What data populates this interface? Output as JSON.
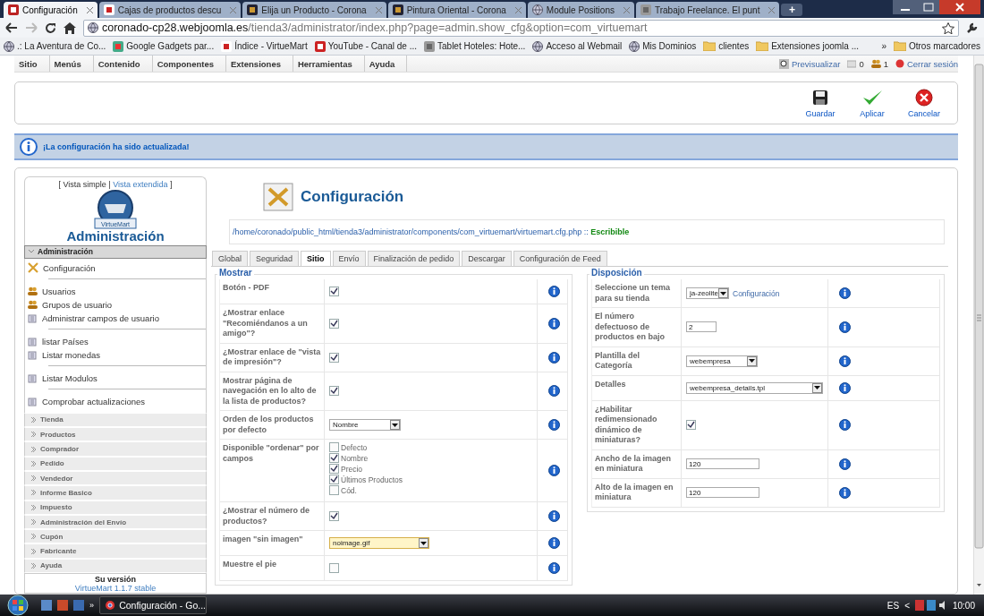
{
  "browser": {
    "tabs": [
      {
        "title": "Configuración",
        "kind": "joomla",
        "selected": true
      },
      {
        "title": "Cajas de productos descu",
        "kind": "w",
        "selected": false
      },
      {
        "title": "Elija un Producto - Corona",
        "kind": "puzzle",
        "selected": false
      },
      {
        "title": "Pintura Oriental - Corona",
        "kind": "puzzle",
        "selected": false
      },
      {
        "title": "Module Positions",
        "kind": "globe",
        "selected": false
      },
      {
        "title": "Trabajo Freelance. El punt",
        "kind": "square",
        "selected": false
      }
    ],
    "new_tab": "+",
    "address": {
      "host": "coronado-cp28.webjoomla.es",
      "path": "/tienda3/administrator/index.php?page=admin.show_cfg&option=com_virtuemart"
    },
    "bookmarks": [
      {
        "label": ".: La Aventura de Co...",
        "kind": "globe"
      },
      {
        "label": "Google Gadgets par...",
        "kind": "google"
      },
      {
        "label": "Índice - VirtueMart",
        "kind": "w"
      },
      {
        "label": "YouTube - Canal de ...",
        "kind": "youtube"
      },
      {
        "label": "Tablet Hoteles: Hote...",
        "kind": "square"
      },
      {
        "label": "Acceso al Webmail",
        "kind": "globe"
      },
      {
        "label": "Mis Dominios",
        "kind": "globe"
      },
      {
        "label": "clientes",
        "kind": "folder"
      },
      {
        "label": "Extensiones joomla ...",
        "kind": "folder"
      }
    ],
    "more": "»",
    "other_bookmarks": "Otros marcadores"
  },
  "admin_menu": {
    "items": [
      "Sitio",
      "Menús",
      "Contenido",
      "Componentes",
      "Extensiones",
      "Herramientas",
      "Ayuda"
    ],
    "preview": "Previsualizar",
    "messages": "0",
    "users": "1",
    "logout": "Cerrar sesión"
  },
  "toolbar": [
    {
      "label": "Guardar",
      "kind": "save"
    },
    {
      "label": "Aplicar",
      "kind": "apply"
    },
    {
      "label": "Cancelar",
      "kind": "cancel"
    }
  ],
  "message": "¡La configuración ha sido actualizada!",
  "sidebar": {
    "view_open": "[",
    "views": [
      {
        "label": "Vista simple",
        "selected": true
      },
      {
        "label": "Vista extendida",
        "selected": false
      }
    ],
    "view_separator": "|",
    "view_close": "]",
    "logo_label": "VirtueMart",
    "title": "Administración",
    "section": {
      "title": "Administración",
      "expanded": true,
      "groups": [
        [
          {
            "label": "Configuración",
            "kind": "tools"
          }
        ],
        [
          {
            "label": "Usuarios",
            "kind": "users"
          },
          {
            "label": "Grupos de usuario",
            "kind": "users"
          },
          {
            "label": "Administrar campos de usuario",
            "kind": "list"
          }
        ],
        [
          {
            "label": "listar Países",
            "kind": "list"
          },
          {
            "label": "Listar monedas",
            "kind": "list"
          }
        ],
        [
          {
            "label": "Listar Modulos",
            "kind": "list"
          }
        ],
        [
          {
            "label": "Comprobar actualizaciones",
            "kind": "list"
          }
        ]
      ]
    },
    "collapsed": [
      {
        "title": "Tienda",
        "expanded": false
      },
      {
        "title": "Productos",
        "expanded": false
      },
      {
        "title": "Comprador",
        "expanded": false
      },
      {
        "title": "Pedido",
        "expanded": false
      },
      {
        "title": "Vendedor",
        "expanded": false
      },
      {
        "title": "Informe Basico",
        "expanded": false
      },
      {
        "title": "Impuesto",
        "expanded": false
      },
      {
        "title": "Administración del Envío",
        "expanded": false
      },
      {
        "title": "Cupón",
        "expanded": false
      },
      {
        "title": "Fabricante",
        "expanded": false
      },
      {
        "title": "Ayuda",
        "expanded": false
      }
    ],
    "version_label": "Su versión",
    "version_link": "VirtueMart 1.1.7 stable"
  },
  "content": {
    "title": "Configuración",
    "path": "/home/coronado/public_html/tienda3/administrator/components/com_virtuemart/virtuemart.cfg.php :: **Escribible**",
    "tabs": [
      {
        "label": "Global",
        "selected": false
      },
      {
        "label": "Seguridad",
        "selected": false
      },
      {
        "label": "Sitio",
        "selected": true
      },
      {
        "label": "Envío",
        "selected": false
      },
      {
        "label": "Finalización de pedido",
        "selected": false
      },
      {
        "label": "Descargar",
        "selected": false
      },
      {
        "label": "Configuración de Feed",
        "selected": false
      }
    ],
    "fieldsets": [
      {
        "legend": "Mostrar",
        "rows": [
          {
            "label": "Botón - PDF",
            "kind": "checkbox",
            "checked": true
          },
          {
            "label": "¿Mostrar enlace \"Recomiéndanos a un amigo\"?",
            "kind": "checkbox",
            "checked": true
          },
          {
            "label": "¿Mostrar enlace de \"vista de impresión\"?",
            "kind": "checkbox",
            "checked": true
          },
          {
            "label": "Mostrar página de navegación en lo alto de la lista de productos?",
            "kind": "checkbox",
            "checked": true
          },
          {
            "label": "Orden de los productos por defecto",
            "kind": "select",
            "value": "Nombre",
            "focused": false
          },
          {
            "label": "Disponible \"ordenar\" por campos",
            "kind": "checklist",
            "options": [
              {
                "label": "Defecto",
                "checked": false
              },
              {
                "label": "Nombre",
                "checked": true
              },
              {
                "label": "Precio",
                "checked": true
              },
              {
                "label": "Últimos Productos",
                "checked": true
              },
              {
                "label": "Cód.",
                "checked": false
              }
            ]
          },
          {
            "label": "¿Mostrar el número de productos?",
            "kind": "checkbox",
            "checked": true
          },
          {
            "label": "imagen \"sin imagen\"",
            "kind": "select",
            "value": "noimage.gif",
            "focused": true
          },
          {
            "label": "Muestre el pie",
            "kind": "checkbox",
            "checked": false
          }
        ]
      },
      {
        "legend": "Disposición",
        "rows": [
          {
            "label": "Seleccione un tema para su tienda",
            "kind": "select_link",
            "value": "ja-zeolite",
            "link": "Configuración"
          },
          {
            "label": "El número defectuoso de productos en bajo",
            "kind": "text",
            "value": "2"
          },
          {
            "label": "Plantilla del Categoría",
            "kind": "select",
            "value": "webempresa",
            "focused": false
          },
          {
            "label": "Detalles",
            "kind": "select",
            "value": "webempresa_details.tpl",
            "focused": false
          },
          {
            "label": "¿Habilitar redimensionado dinámico de miniaturas?",
            "kind": "checkbox",
            "checked": true
          },
          {
            "label": "Ancho de la imagen en miniatura",
            "kind": "text",
            "value": "120"
          },
          {
            "label": "Alto de la imagen en miniatura",
            "kind": "text",
            "value": "120"
          }
        ]
      }
    ]
  },
  "taskbar": {
    "more": "»",
    "task": "Configuración - Go...",
    "language": "ES",
    "tray_toggle": "<",
    "clock": "10:00"
  }
}
